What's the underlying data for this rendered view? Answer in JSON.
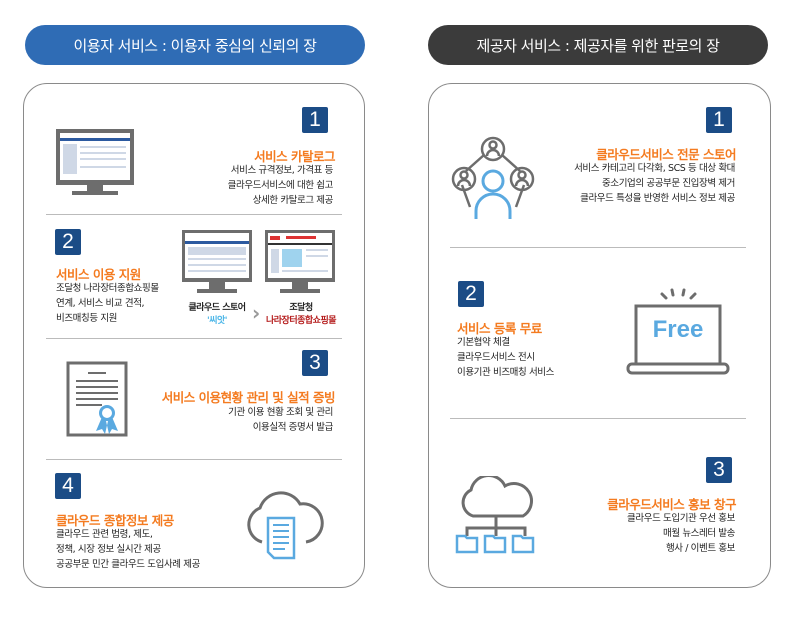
{
  "user_header": "이용자 서비스 : 이용자 중심의 신뢰의 장",
  "provider_header": "제공자 서비스 : 제공자를 위한 판로의 장",
  "colors": {
    "user_header": "#2f6cb5",
    "provider_header": "#3b3b3b",
    "title": "#f47b20",
    "badge": "#1b4c86",
    "icon_blue": "#5aa9e0",
    "icon_gray": "#6d6d6d"
  },
  "user_items": [
    {
      "num": "1",
      "title": "서비스 카탈로그",
      "lines": [
        "서비스 규격정보, 가격표 등",
        "클라우드서비스에 대한 쉽고",
        "상세한 카탈로그 제공"
      ],
      "icon": "monitor-icon"
    },
    {
      "num": "2",
      "title": "서비스 이용 지원",
      "lines": [
        "조달청 나라장터종합쇼핑몰",
        "연계, 서비스 비교 견적,",
        "비즈매칭등 지원"
      ],
      "icon": "monitor-icon",
      "store_label": "클라우드 스토어",
      "store_name": "'씨앗'",
      "mall_label": "조달청",
      "mall_name": "나라장터종합쇼핑몰"
    },
    {
      "num": "3",
      "title": "서비스 이용현황 관리 및 실적 증빙",
      "lines": [
        "기관 이용 현황 조회 및 관리",
        "이용실적 증명서 발급"
      ],
      "icon": "certificate-icon"
    },
    {
      "num": "4",
      "title": "클라우드 종합정보 제공",
      "lines": [
        "클라우드 관련 법령, 제도,",
        "정책, 시장 정보 실시간 제공",
        "공공부문 민간 클라우드 도입사례 제공"
      ],
      "icon": "cloud-document-icon"
    }
  ],
  "provider_items": [
    {
      "num": "1",
      "title": "클라우드서비스 전문 스토어",
      "lines": [
        "서비스 카테고리 다각화, SCS 등 대상 확대",
        "중소기업의 공공부문 진입장벽 제거",
        "클라우드 특성을 반영한 서비스 정보 제공"
      ],
      "icon": "user-network-icon"
    },
    {
      "num": "2",
      "title": "서비스 등록 무료",
      "lines": [
        "기본협약 체결",
        "클라우드서비스 전시",
        "이용기관 비즈매칭 서비스"
      ],
      "icon": "laptop-free-icon",
      "free_label": "Free"
    },
    {
      "num": "3",
      "title": "클라우드서비스 홍보 창구",
      "lines": [
        "클라우드 도입기관 우선 홍보",
        "매월 뉴스레터 발송",
        "행사 / 이벤트 홍보"
      ],
      "icon": "cloud-folders-icon"
    }
  ]
}
